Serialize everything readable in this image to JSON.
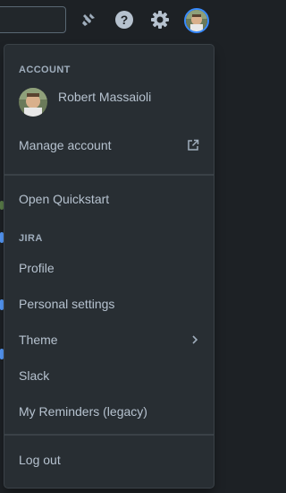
{
  "topbar": {
    "icons": [
      "search-box",
      "notifications-icon",
      "help-icon",
      "settings-icon",
      "avatar"
    ]
  },
  "menu": {
    "account_heading": "ACCOUNT",
    "user_name": "Robert Massaioli",
    "manage_account": "Manage account",
    "open_quickstart": "Open Quickstart",
    "jira_heading": "JIRA",
    "items": [
      {
        "label": "Profile"
      },
      {
        "label": "Personal settings"
      },
      {
        "label": "Theme"
      },
      {
        "label": "Slack"
      },
      {
        "label": "My Reminders (legacy)"
      }
    ],
    "log_out": "Log out"
  },
  "colors": {
    "background": "#1d2125",
    "menu_bg": "#282e33",
    "text": "#b6c2cf",
    "heading": "#9fadbc",
    "accent": "#388bff"
  }
}
